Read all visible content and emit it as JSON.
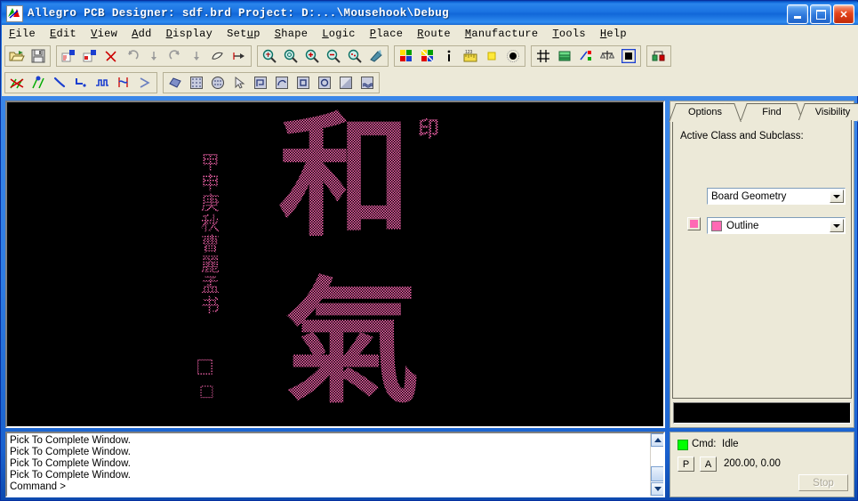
{
  "window": {
    "title": "Allegro PCB Designer: sdf.brd   Project: D:...\\Mousehook\\Debug",
    "app_icon": "allegro-icon",
    "controls": {
      "minimize": "minimize-button",
      "maximize": "maximize-button",
      "close": "close-button"
    }
  },
  "menubar": {
    "items": [
      {
        "label": "File",
        "accel": "F"
      },
      {
        "label": "Edit",
        "accel": "E"
      },
      {
        "label": "View",
        "accel": "V"
      },
      {
        "label": "Add",
        "accel": "A"
      },
      {
        "label": "Display",
        "accel": "D"
      },
      {
        "label": "Setup",
        "accel": "u"
      },
      {
        "label": "Shape",
        "accel": "S"
      },
      {
        "label": "Logic",
        "accel": "L"
      },
      {
        "label": "Place",
        "accel": "P"
      },
      {
        "label": "Route",
        "accel": "R"
      },
      {
        "label": "Manufacture",
        "accel": "M"
      },
      {
        "label": "Tools",
        "accel": "T"
      },
      {
        "label": "Help",
        "accel": "H"
      }
    ]
  },
  "toolbar1": {
    "groups": [
      {
        "buttons": [
          {
            "name": "open-icon",
            "tip": "Open"
          },
          {
            "name": "save-icon",
            "tip": "Save"
          }
        ]
      },
      {
        "buttons": [
          {
            "name": "cut-from-icon",
            "tip": "Cut"
          },
          {
            "name": "copy-to-icon",
            "tip": "Copy"
          },
          {
            "name": "delete-icon",
            "tip": "Delete"
          },
          {
            "name": "undo-icon",
            "tip": "Undo"
          },
          {
            "name": "undo-step-icon",
            "tip": "Undo Step"
          },
          {
            "name": "redo-icon",
            "tip": "Redo"
          },
          {
            "name": "redo-step-icon",
            "tip": "Redo Step"
          },
          {
            "name": "move-icon",
            "tip": "Move"
          },
          {
            "name": "mirror-icon",
            "tip": "Mirror"
          }
        ]
      },
      {
        "buttons": [
          {
            "name": "zoom-fit-icon",
            "tip": "Zoom Fit"
          },
          {
            "name": "zoom-world-icon",
            "tip": "Zoom World"
          },
          {
            "name": "zoom-in-icon",
            "tip": "Zoom In"
          },
          {
            "name": "zoom-out-icon",
            "tip": "Zoom Out"
          },
          {
            "name": "zoom-points-icon",
            "tip": "Zoom Points"
          },
          {
            "name": "refresh-icon",
            "tip": "Redraw"
          }
        ]
      },
      {
        "buttons": [
          {
            "name": "color-layers-icon",
            "tip": "Color/Visibility"
          },
          {
            "name": "color-palette-icon",
            "tip": "Color Palette"
          },
          {
            "name": "info-icon",
            "tip": "Show Element"
          },
          {
            "name": "measure-icon",
            "tip": "Measure"
          },
          {
            "name": "highlight-icon",
            "tip": "Highlight"
          },
          {
            "name": "dehighlight-icon",
            "tip": "Dehighlight"
          }
        ]
      },
      {
        "buttons": [
          {
            "name": "grid-icon",
            "tip": "Grid Toggle"
          },
          {
            "name": "layers-icon",
            "tip": "Subclass"
          },
          {
            "name": "constraint-icon",
            "tip": "Constraint Manager"
          },
          {
            "name": "drc-icon",
            "tip": "DRC"
          },
          {
            "name": "shape-select-icon",
            "tip": "Shape Select"
          }
        ]
      },
      {
        "buttons": [
          {
            "name": "netlist-icon",
            "tip": "Netlist"
          }
        ]
      }
    ]
  },
  "toolbar2": {
    "groups": [
      {
        "buttons": [
          {
            "name": "unroute-icon",
            "tip": "Unroute"
          },
          {
            "name": "route-net-icon",
            "tip": "Route Net"
          },
          {
            "name": "add-line-icon",
            "tip": "Add Line"
          },
          {
            "name": "add-corner-icon",
            "tip": "Add Connect"
          },
          {
            "name": "delay-tune-icon",
            "tip": "Delay Tune"
          },
          {
            "name": "slide-icon",
            "tip": "Slide"
          },
          {
            "name": "custom-smooth-icon",
            "tip": "Custom Smooth"
          }
        ]
      },
      {
        "buttons": [
          {
            "name": "shape-add-icon",
            "tip": "Shape Add Rect"
          },
          {
            "name": "shape-grid-icon",
            "tip": "Shape Grid"
          },
          {
            "name": "shape-circle-icon",
            "tip": "Shape Circle"
          },
          {
            "name": "shape-select-cursor-icon",
            "tip": "Shape Select"
          },
          {
            "name": "shape-edit-boundary-icon",
            "tip": "Edit Boundary"
          },
          {
            "name": "shape-void-icon",
            "tip": "Create Void"
          },
          {
            "name": "shape-delete-void-icon",
            "tip": "Delete Void"
          },
          {
            "name": "shape-merge-icon",
            "tip": "Merge Shapes"
          },
          {
            "name": "shape-change-icon",
            "tip": "Change Shape"
          },
          {
            "name": "shape-compose-icon",
            "tip": "Compose Shape"
          }
        ]
      }
    ]
  },
  "canvas": {
    "background_color": "#000000",
    "artwork_color": "#ff69b4",
    "artwork": {
      "main_glyphs": [
        "和",
        "氣"
      ],
      "seal_top_right": "印",
      "column_text": "甲申庚秋曹麗孟书",
      "seal_bottom": [
        "□",
        "□"
      ]
    }
  },
  "right_panel": {
    "tabs": [
      {
        "label": "Options",
        "active": true
      },
      {
        "label": "Find",
        "active": false
      },
      {
        "label": "Visibility",
        "active": false
      }
    ],
    "options": {
      "section_label": "Active Class and Subclass:",
      "class_value": "Board Geometry",
      "subclass_value": "Outline",
      "subclass_color": "#ff69b4",
      "active_swatch_color": "#ff69b4"
    }
  },
  "console": {
    "lines": [
      "Pick To Complete Window.",
      "Pick To Complete Window.",
      "Pick To Complete Window.",
      "Pick To Complete Window.",
      "Command >"
    ],
    "text": "Pick To Complete Window.\nPick To Complete Window.\nPick To Complete Window.\nPick To Complete Window.\nCommand >"
  },
  "status": {
    "led_color": "#00ff00",
    "cmd_label": "Cmd:",
    "cmd_state": "Idle",
    "pick_button": "P",
    "absolute_button": "A",
    "coordinates": "200.00, 0.00",
    "stop_label": "Stop"
  }
}
